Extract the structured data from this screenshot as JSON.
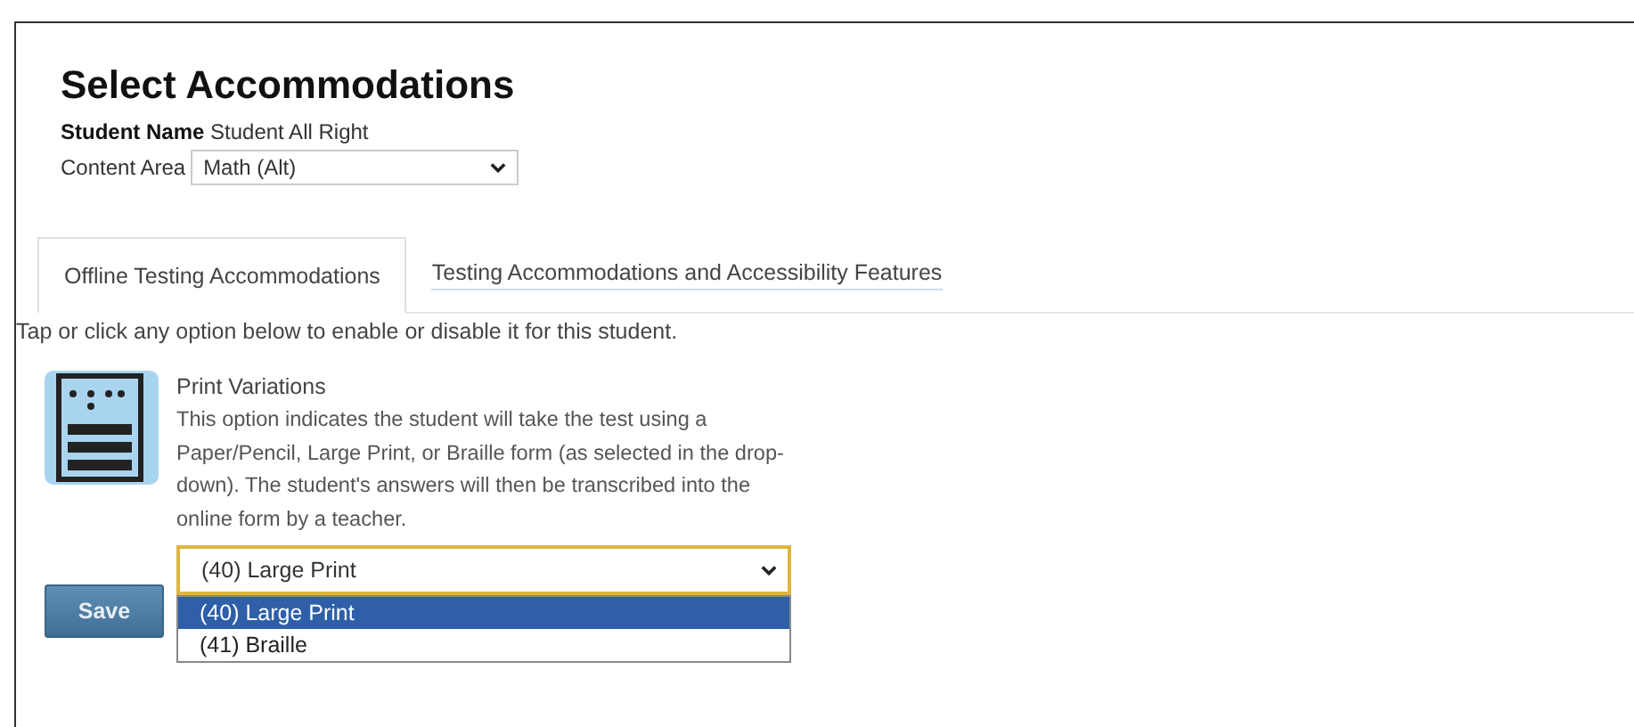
{
  "title": "Select Accommodations",
  "student": {
    "label": "Student Name",
    "value": "Student All Right"
  },
  "content_area": {
    "label": "Content Area",
    "value": "Math (Alt)"
  },
  "tabs": [
    {
      "label": "Offline Testing Accommodations",
      "selected": true
    },
    {
      "label": "Testing Accommodations and Accessibility Features",
      "selected": false
    }
  ],
  "hint": "Tap or click any option below to enable or disable it for this student.",
  "option": {
    "title": "Print Variations",
    "description": "This option indicates the student will take the test using a Paper/Pencil, Large Print, or Braille form (as selected in the drop-down). The student's answers will then be transcribed into the online form by a teacher.",
    "value": "(40) Large Print",
    "choices": [
      {
        "label": "(40) Large Print",
        "selected": true
      },
      {
        "label": "(41) Braille",
        "selected": false
      }
    ]
  },
  "buttons": [
    {
      "label": "Save"
    }
  ]
}
